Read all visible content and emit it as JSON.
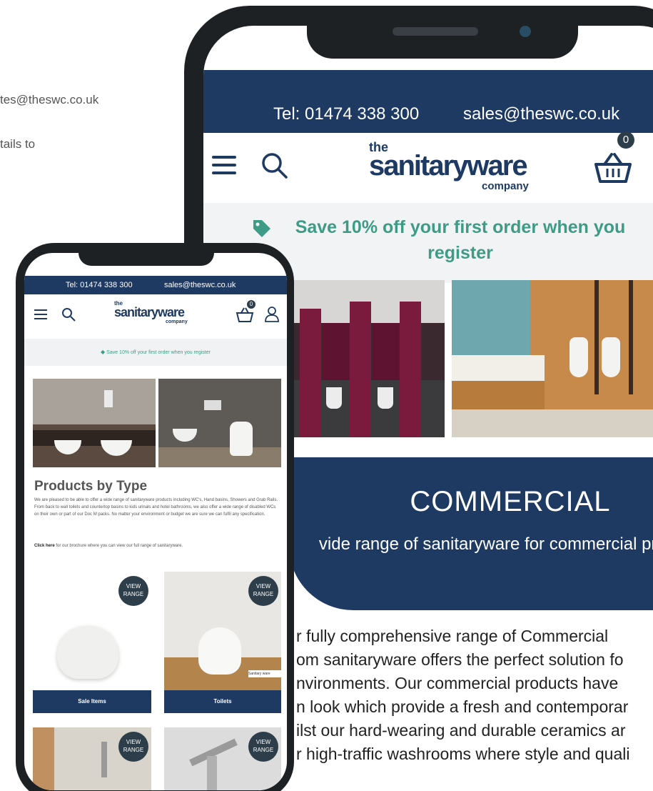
{
  "background": {
    "email_fragment": "tes@theswc.co.uk",
    "details_fragment": "tails to"
  },
  "big_phone": {
    "topbar": {
      "tel": "Tel: 01474 338 300",
      "email": "sales@theswc.co.uk"
    },
    "logo": {
      "the": "the",
      "name": "sanitaryware",
      "sub": "company"
    },
    "basket_count": "0",
    "promo": "Save 10% off your first order when you register",
    "category_title": "COMMERCIAL",
    "category_subtitle": "vide range of sanitaryware for commercial projects",
    "body_lines": [
      "r fully comprehensive range of Commercial",
      "om sanitaryware offers the perfect solution fo",
      "nvironments. Our commercial products have",
      "n look which provide a fresh and contemporar",
      "ilst our hard-wearing and durable ceramics ar",
      "r high-traffic washrooms where style and quali"
    ]
  },
  "small_phone": {
    "topbar": {
      "tel": "Tel: 01474 338 300",
      "email": "sales@theswc.co.uk"
    },
    "logo": {
      "the": "the",
      "name": "sanitaryware",
      "sub": "company"
    },
    "basket_count": "0",
    "promo": "Save 10% off your first order when you register",
    "section_title": "Products by Type",
    "paragraph": "We are pleased to be able to offer a wide range of sanitaryware products including WC's, Hand basins, Showers and Grab Rails. From back to wall toilets and countertop basins to kids urinals and hotel bathrooms, we also offer a wide range of disabled WCs on their own or part of our Doc M packs. No matter your environment or budget we are sure we can fulfil any specification.",
    "click_here": "Click here",
    "click_rest": " for our brochure where you can view our full range of sanitaryware.",
    "view_range": "VIEW RANGE",
    "tiles": [
      {
        "label": "Sale Items"
      },
      {
        "label": "Toilets"
      },
      {
        "label": ""
      },
      {
        "label": ""
      }
    ],
    "badge_text": "Sanitary ware"
  },
  "colors": {
    "navy": "#1e3a63",
    "teal": "#3e9b86",
    "phone": "#1e2124"
  }
}
